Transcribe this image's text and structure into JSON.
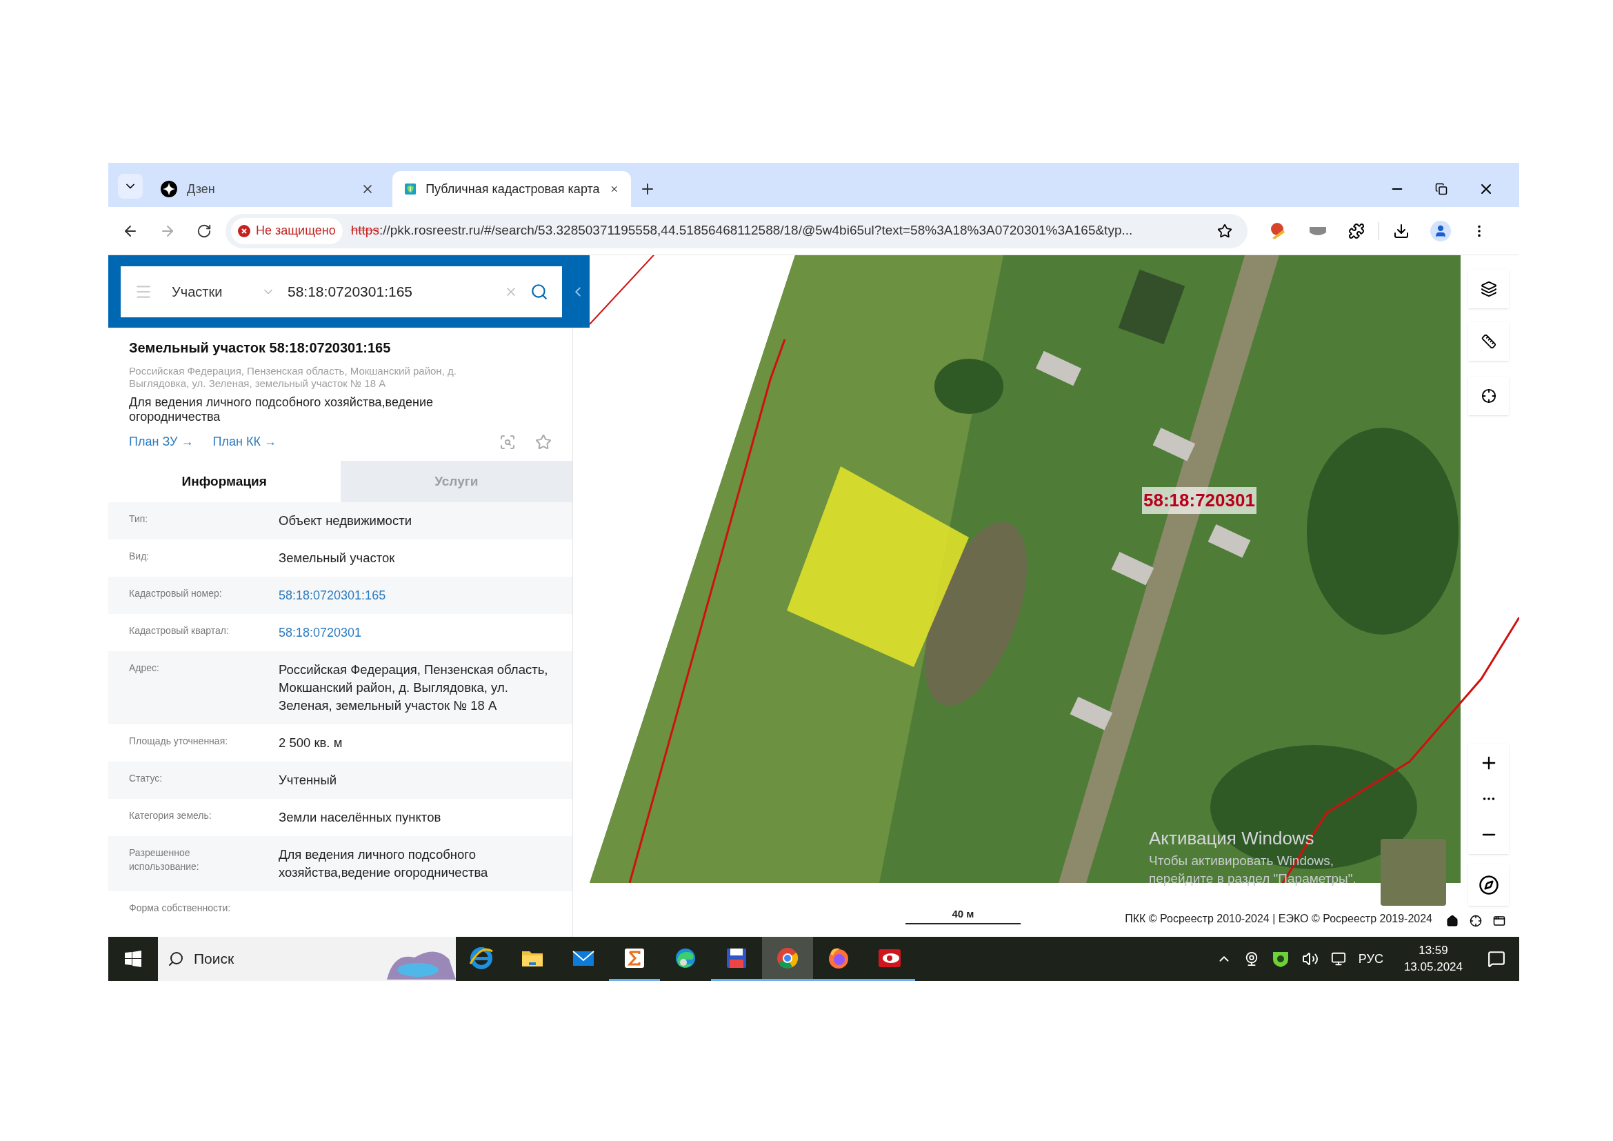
{
  "browser": {
    "tabs": [
      {
        "title": "Дзен",
        "selected": false,
        "kind": "dzen"
      },
      {
        "title": "Публичная кадастровая карта",
        "selected": true,
        "kind": "cadastre"
      }
    ],
    "address": {
      "security": "Не защищено",
      "scheme": "https",
      "rest": "://pkk.rosreestr.ru/#/search/53.32850371195558,44.51856468112588/18/@5w4bi65ul?text=58%3A18%3A0720301%3A165&typ..."
    }
  },
  "panel": {
    "search": {
      "category": "Участки",
      "value": "58:18:0720301:165"
    },
    "card": {
      "title": "Земельный участок 58:18:0720301:165",
      "address": "Российская Федерация, Пензенская область, Мокшанский район, д. Выглядовка, ул. Зеленая, земельный участок № 18 А",
      "purpose": "Для ведения личного подсобного хозяйства,ведение огородничества",
      "links": [
        "План ЗУ →",
        "План КК →"
      ]
    },
    "tabs": [
      {
        "label": "Информация",
        "selected": true
      },
      {
        "label": "Услуги",
        "selected": false
      }
    ],
    "rows": [
      {
        "label": "Тип:",
        "value": "Объект недвижимости",
        "kind": "text"
      },
      {
        "label": "Вид:",
        "value": "Земельный участок",
        "kind": "text"
      },
      {
        "label": "Кадастровый номер:",
        "value": "58:18:0720301:165",
        "kind": "link"
      },
      {
        "label": "Кадастровый квартал:",
        "value": "58:18:0720301",
        "kind": "link"
      },
      {
        "label": "Адрес:",
        "value": "Российская Федерация, Пензенская область, Мокшанский район, д. Выглядовка, ул. Зеленая, земельный участок № 18 А",
        "kind": "text"
      },
      {
        "label": "Площадь уточненная:",
        "value": "2 500 кв. м",
        "kind": "text"
      },
      {
        "label": "Статус:",
        "value": "Учтенный",
        "kind": "text"
      },
      {
        "label": "Категория земель:",
        "value": "Земли населённых пунктов",
        "kind": "text"
      },
      {
        "label": "Разрешенное использование:",
        "value": "Для ведения личного подсобного хозяйства,ведение огородничества",
        "kind": "text"
      },
      {
        "label": "Форма собственности:"
      }
    ]
  },
  "map": {
    "quarter_label": "58:18:720301",
    "scale": "40 м",
    "attribution": "ПКК © Росреестр 2010-2024 | ЕЭКО © Росреестр 2019-2024",
    "notice": {
      "title": "Активация Windows",
      "text": "Чтобы активировать Windows, перейдите в раздел \"Параметры\"."
    }
  },
  "taskbar": {
    "search_placeholder": "Поиск",
    "apps": [
      {
        "kind": "ie",
        "running": false,
        "selected": false
      },
      {
        "kind": "folder",
        "running": false,
        "selected": false
      },
      {
        "kind": "mail",
        "running": false,
        "selected": false
      },
      {
        "kind": "sigma",
        "running": true,
        "selected": false
      },
      {
        "kind": "edge",
        "running": false,
        "selected": false
      },
      {
        "kind": "floppy",
        "running": true,
        "selected": false
      },
      {
        "kind": "chrome",
        "running": true,
        "selected": true
      },
      {
        "kind": "firefox",
        "running": true,
        "selected": false
      },
      {
        "kind": "redapp",
        "running": true,
        "selected": false
      }
    ],
    "language": "РУС",
    "time": "13:59",
    "date": "13.05.2024"
  }
}
